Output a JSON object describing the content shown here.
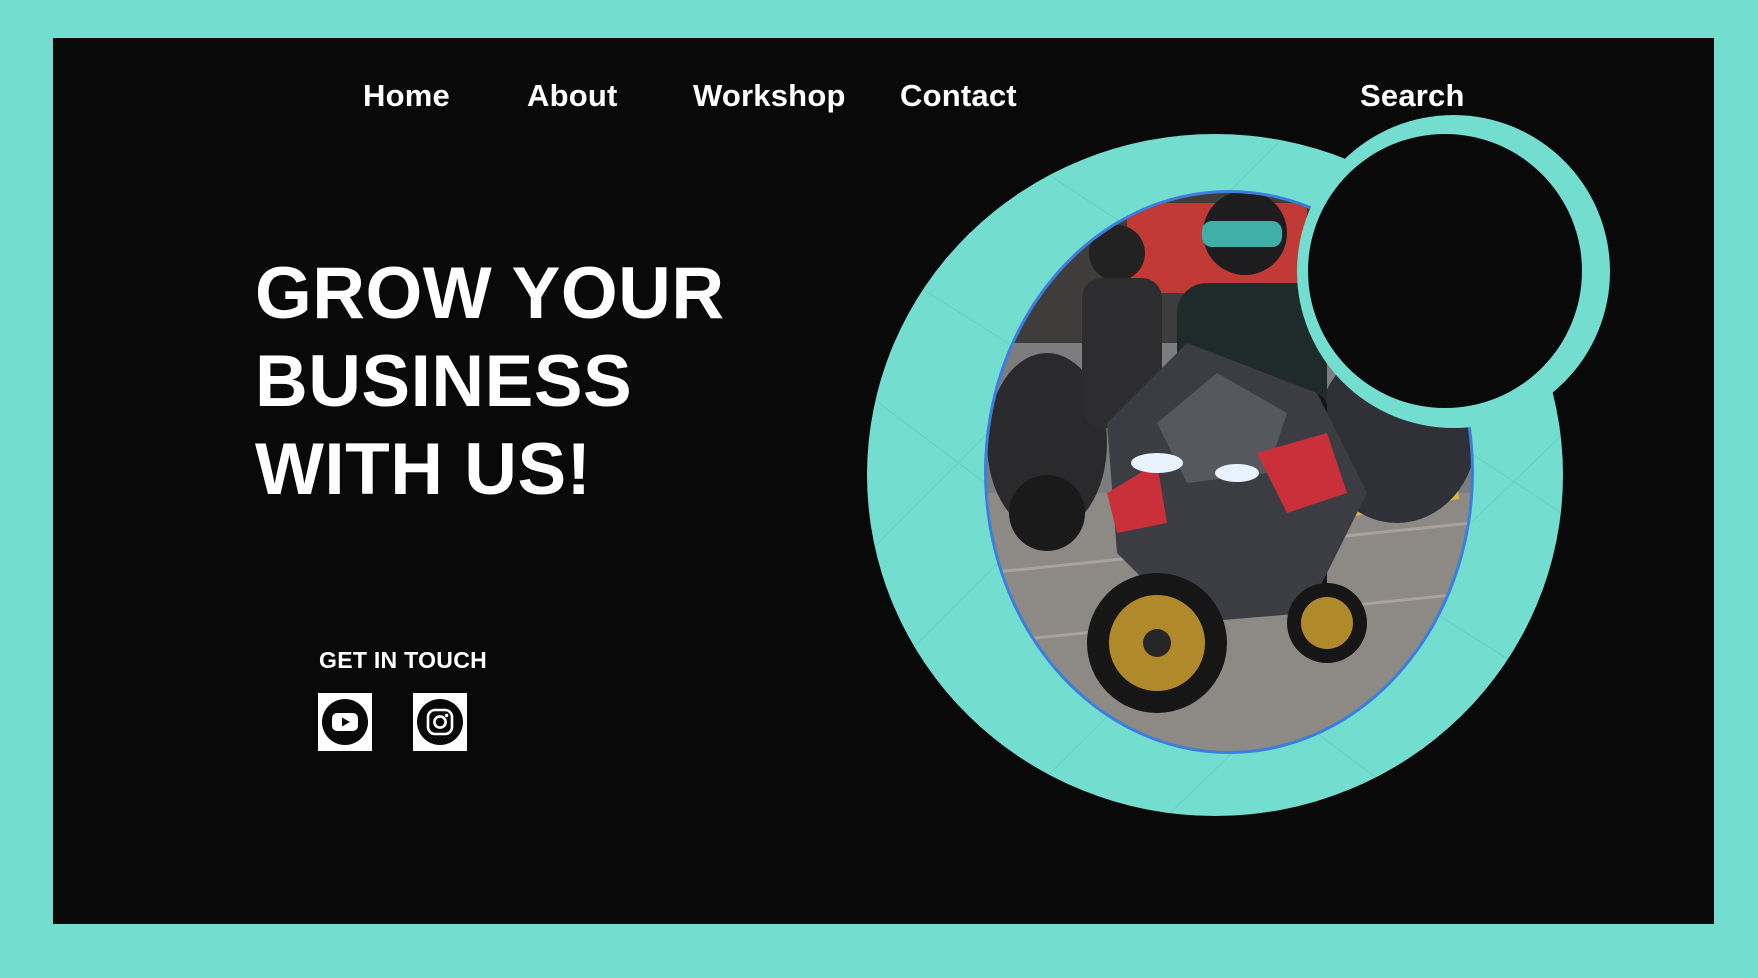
{
  "nav": {
    "home": "Home",
    "about": "About",
    "workshop": "Workshop",
    "contact": "Contact",
    "search": "Search"
  },
  "hero": {
    "line1": "GROW YOUR",
    "line2": "BUSINESS",
    "line3": "WITH US!"
  },
  "contact": {
    "label": "GET IN TOUCH"
  },
  "social": {
    "youtube_icon": "youtube-icon",
    "instagram_icon": "instagram-icon"
  },
  "colors": {
    "background": "#73ddd0",
    "panel": "#0a090a",
    "accent_ring": "#73ddd0",
    "photo_border": "#3b7de0",
    "text": "#ffffff"
  }
}
